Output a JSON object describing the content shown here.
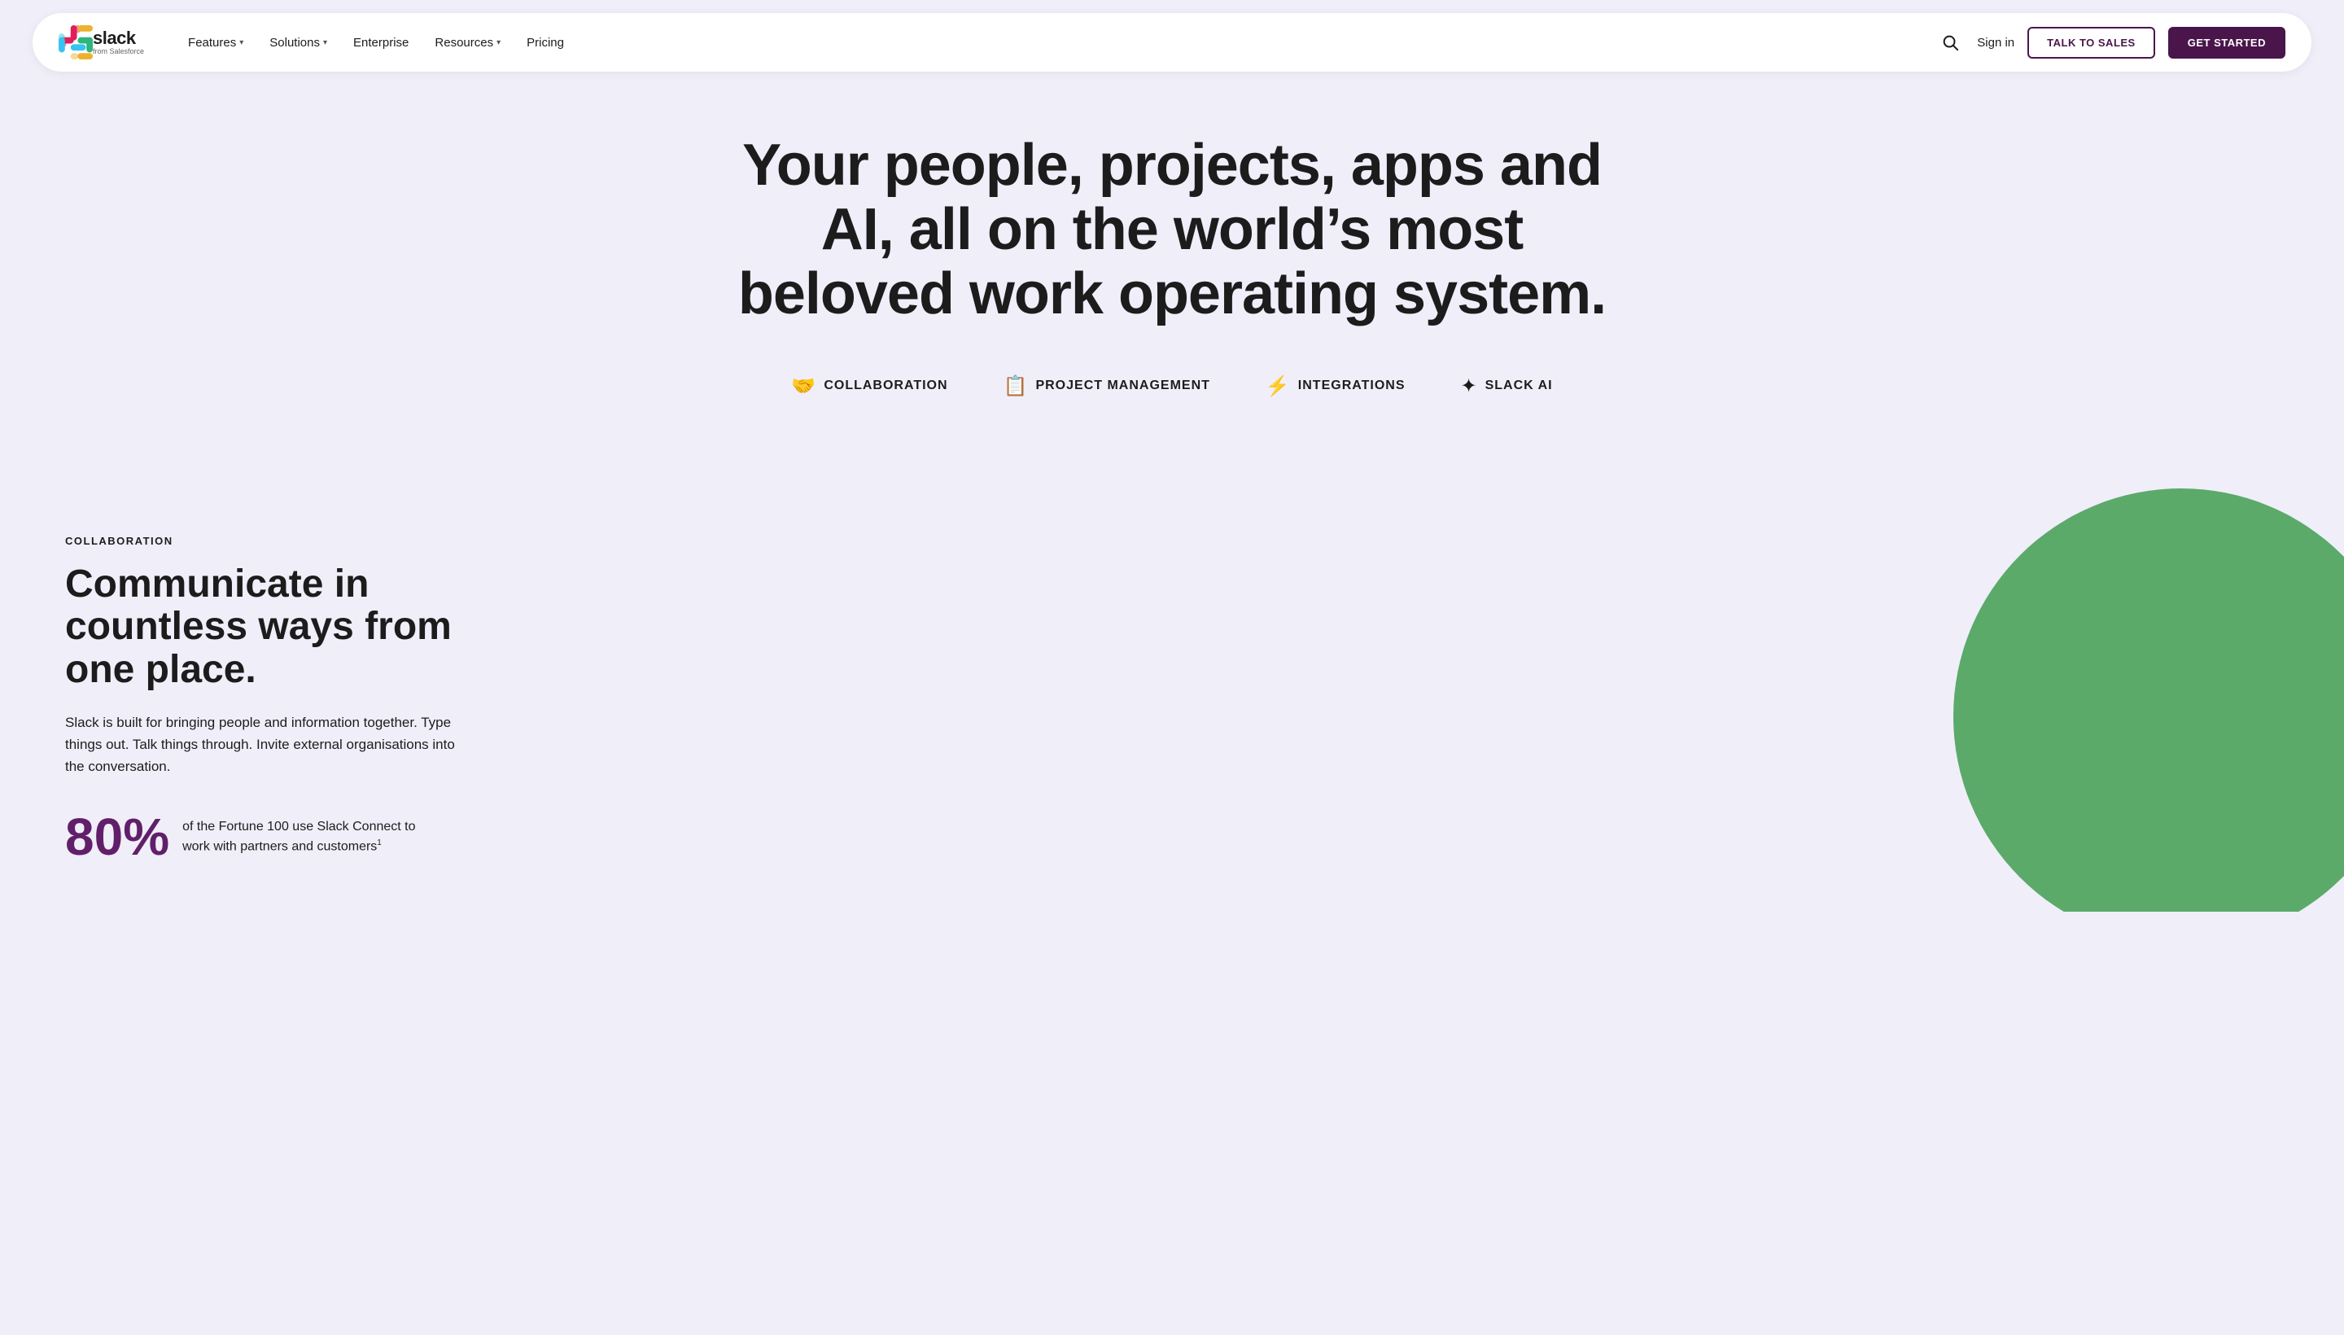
{
  "nav": {
    "logo_alt": "Slack from Salesforce",
    "logo_slack": "slack",
    "logo_salesforce": "from Salesforce",
    "links": [
      {
        "label": "Features",
        "has_dropdown": true
      },
      {
        "label": "Solutions",
        "has_dropdown": true
      },
      {
        "label": "Enterprise",
        "has_dropdown": false
      },
      {
        "label": "Resources",
        "has_dropdown": true
      },
      {
        "label": "Pricing",
        "has_dropdown": false
      }
    ],
    "sign_in": "Sign in",
    "talk_to_sales": "TALK TO SALES",
    "get_started": "GET STARTED"
  },
  "hero": {
    "title": "Your people, projects, apps and AI, all on the world’s most beloved work operating system."
  },
  "feature_tabs": [
    {
      "id": "collaboration",
      "label": "COLLABORATION",
      "icon": "🤝"
    },
    {
      "id": "project-management",
      "label": "PROJECT MANAGEMENT",
      "icon": "📋"
    },
    {
      "id": "integrations",
      "label": "INTEGRATIONS",
      "icon": "⚡"
    },
    {
      "id": "slack-ai",
      "label": "SLACK AI",
      "icon": "✦"
    }
  ],
  "collaboration_section": {
    "label": "COLLABORATION",
    "heading": "Communicate in countless ways from one place.",
    "description": "Slack is built for bringing people and information together. Type things out. Talk things through. Invite external organisations into the conversation.",
    "stat_number": "80%",
    "stat_text": "of the Fortune 100 use Slack Connect to work with partners and customers",
    "stat_superscript": "1"
  }
}
